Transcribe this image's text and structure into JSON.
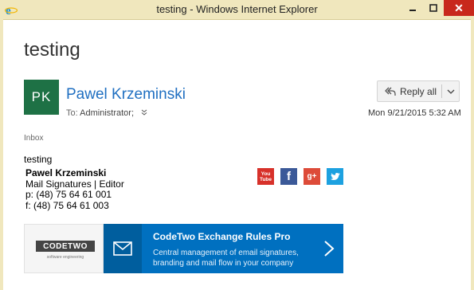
{
  "window": {
    "title": "testing - Windows Internet Explorer"
  },
  "message": {
    "subject": "testing",
    "avatar_initials": "PK",
    "sender": "Pawel Krzeminski",
    "to_label": "To:",
    "to_value": "Administrator;",
    "reply_label": "Reply all",
    "date": "Mon 9/21/2015 5:32 AM",
    "folder": "Inbox",
    "body_text": "testing"
  },
  "signature": {
    "name": "Pawel Krzeminski",
    "role": "Mail Signatures | Editor",
    "phone": "p: (48) 75 64 61 001",
    "fax": "f: (48) 75 64 61 003",
    "social": {
      "youtube": "You Tube",
      "facebook": "f",
      "googleplus": "g+"
    }
  },
  "banner": {
    "logo": "CODETWO",
    "logo_tag": "software engineering",
    "title": "CodeTwo Exchange Rules Pro",
    "description": "Central management of email signatures, branding and mail flow in your company"
  },
  "colors": {
    "accent": "#1f6fc1",
    "avatar": "#1e7145",
    "banner": "#0070c0",
    "titlebar": "#f0e7bd"
  }
}
